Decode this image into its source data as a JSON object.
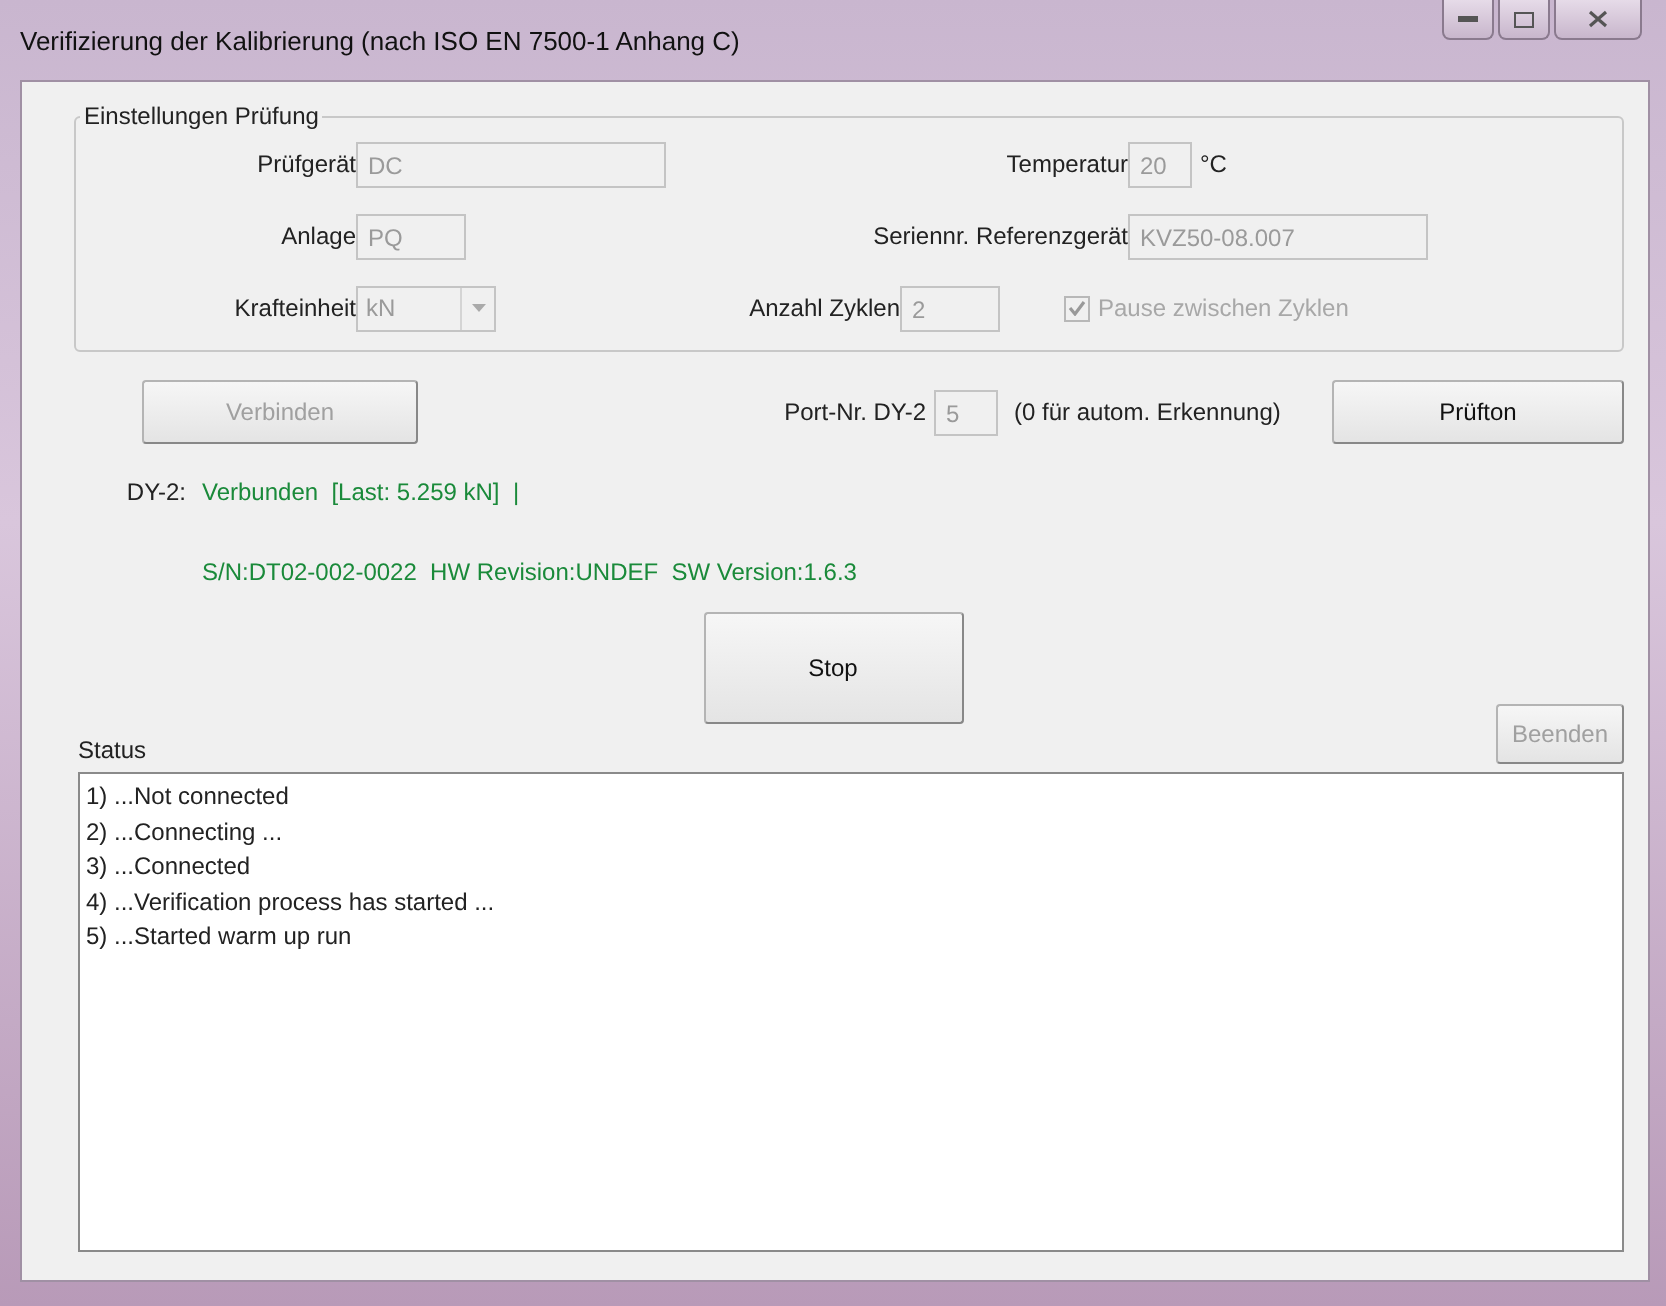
{
  "window": {
    "title": "Verifizierung der Kalibrierung (nach ISO EN 7500-1 Anhang C)"
  },
  "settings": {
    "title": "Einstellungen Prüfung",
    "pruefgeraet": {
      "label": "Prüfgerät",
      "value": "DC",
      "disabled": true
    },
    "temperatur": {
      "label": "Temperatur",
      "value": "20",
      "unit": "°C",
      "disabled": true
    },
    "anlage": {
      "label": "Anlage",
      "value": "PQ",
      "disabled": true
    },
    "seriennr": {
      "label": "Seriennr. Referenzgerät",
      "value": "KVZ50-08.007",
      "disabled": true
    },
    "krafteinheit": {
      "label": "Krafteinheit",
      "value": "kN",
      "disabled": true
    },
    "zyklen": {
      "label": "Anzahl Zyklen",
      "value": "2",
      "disabled": true
    },
    "pause": {
      "label": "Pause zwischen Zyklen",
      "checked": true,
      "disabled": true
    }
  },
  "connect_button": {
    "label": "Verbinden",
    "disabled": true
  },
  "port": {
    "label": "Port-Nr. DY-2",
    "value": "5",
    "hint": "(0 für autom. Erkennung)",
    "disabled": true
  },
  "pruefton_button": {
    "label": "Prüfton",
    "disabled": false
  },
  "device": {
    "label": "DY-2:",
    "status": "Verbunden  [Last: 5.259 kN]  |",
    "info": "S/N:DT02-002-0022  HW Revision:UNDEF  SW Version:1.6.3"
  },
  "stop_button": {
    "label": "Stop",
    "disabled": false
  },
  "status_label": "Status",
  "beenden_button": {
    "label": "Beenden",
    "disabled": true
  },
  "log": [
    "1) ...Not connected",
    "2) ...Connecting ...",
    "3) ...Connected",
    "4) ...Verification process has started ...",
    "5) ...Started warm up run"
  ]
}
